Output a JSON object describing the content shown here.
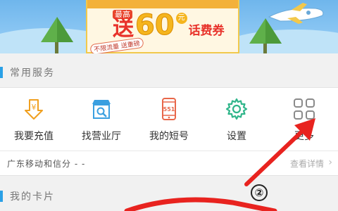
{
  "banner": {
    "promo_tag": "最高",
    "promo_prefix": "送",
    "promo_amount": "60",
    "promo_unit": "元",
    "promo_suffix": "话费券",
    "promo_note": "不限流量 送重磅"
  },
  "services_section": {
    "title": "常用服务"
  },
  "services": [
    {
      "label": "我要充值",
      "icon": "recharge-coin-icon"
    },
    {
      "label": "找营业厅",
      "icon": "store-search-icon"
    },
    {
      "label": "我的短号",
      "icon": "short-number-phone-icon",
      "badge": "551"
    },
    {
      "label": "设置",
      "icon": "gear-icon"
    },
    {
      "label": "更多",
      "icon": "more-grid-icon"
    }
  ],
  "info_row": {
    "text": "广东移动和信分 - -",
    "link": "查看详情"
  },
  "cards_section": {
    "title": "我的卡片"
  },
  "annotation": {
    "marker": "②",
    "color": "#e8231f"
  }
}
